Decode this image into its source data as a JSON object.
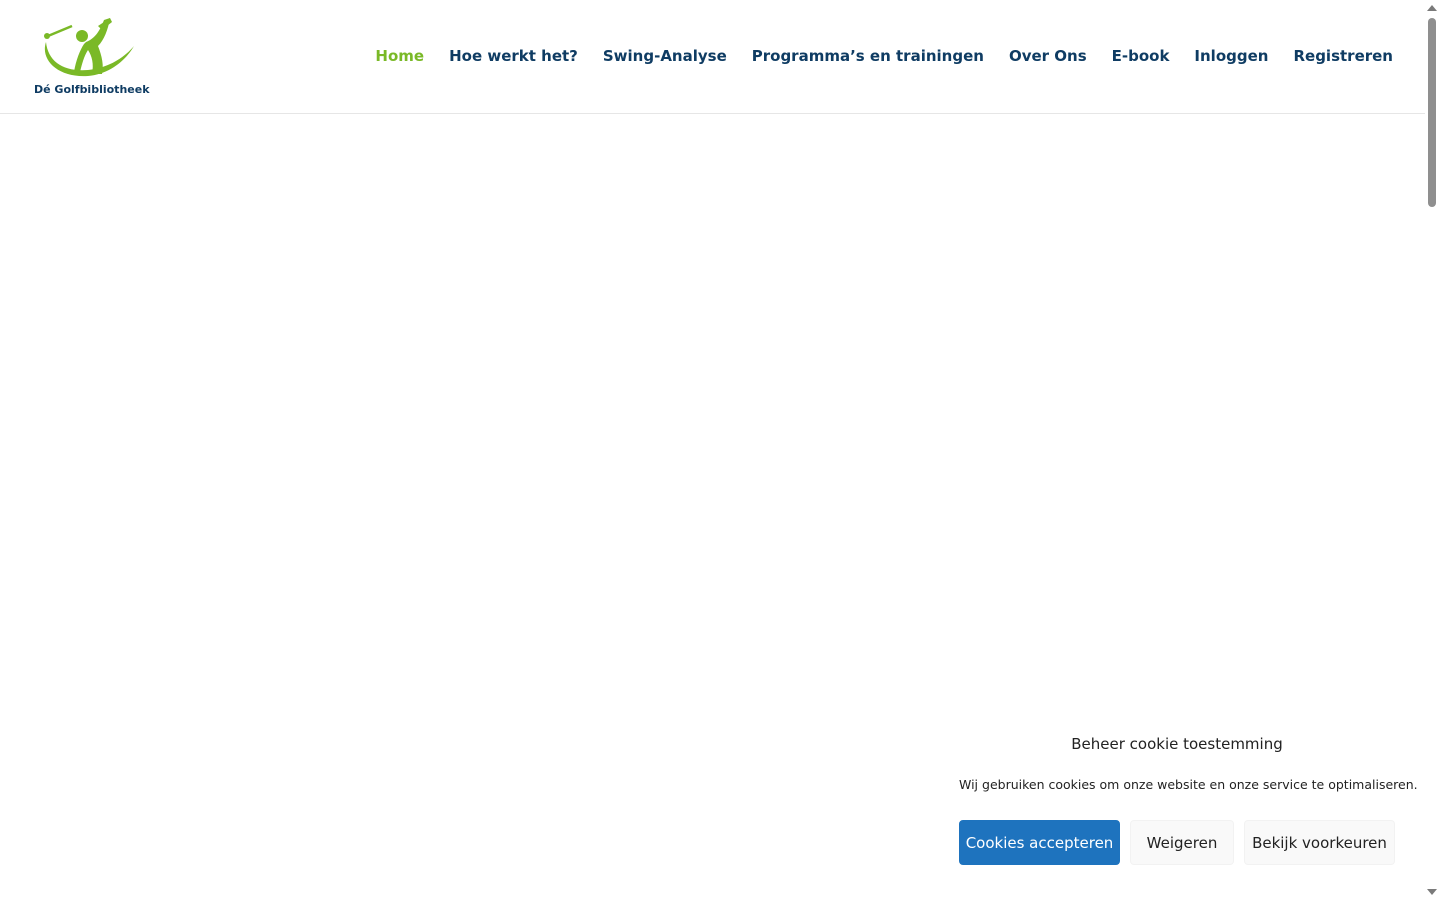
{
  "brand": {
    "name": "Dé Golfbibliotheek",
    "logo_icon": "golfer-swing-logo",
    "primary_color": "#0f3c63",
    "accent_color": "#7ab927"
  },
  "nav": {
    "items": [
      {
        "label": "Home",
        "active": true
      },
      {
        "label": "Hoe werkt het?",
        "active": false
      },
      {
        "label": "Swing-Analyse",
        "active": false
      },
      {
        "label": "Programma’s en trainingen",
        "active": false
      },
      {
        "label": "Over Ons",
        "active": false
      },
      {
        "label": "E-book",
        "active": false
      },
      {
        "label": "Inloggen",
        "active": false
      },
      {
        "label": "Registreren",
        "active": false
      }
    ]
  },
  "cookie_banner": {
    "title": "Beheer cookie toestemming",
    "text": "Wij gebruiken cookies om onze website en onze service te optimaliseren.",
    "accept_label": "Cookies accepteren",
    "deny_label": "Weigeren",
    "preferences_label": "Bekijk voorkeuren",
    "accept_color": "#1e73be"
  }
}
